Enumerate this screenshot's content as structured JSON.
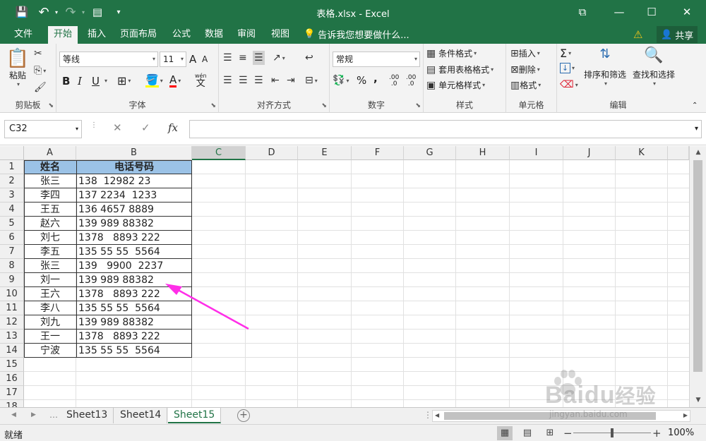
{
  "titlebar": {
    "title": "表格.xlsx - Excel",
    "save": "💾",
    "undo": "↶",
    "redo": "↷",
    "form": "▤",
    "customize": "▾",
    "ribbon_options": "⧉",
    "minimize": "—",
    "maximize": "☐",
    "close": "✕"
  },
  "tabs": [
    "文件",
    "开始",
    "插入",
    "页面布局",
    "公式",
    "数据",
    "审阅",
    "视图"
  ],
  "tell_me": "告诉我您想要做什么...",
  "share": "共享",
  "ribbon": {
    "clipboard": {
      "paste": "粘贴",
      "label": "剪贴板"
    },
    "font": {
      "name": "等线",
      "size": "11",
      "label": "字体",
      "bold": "B",
      "italic": "I",
      "underline": "U",
      "a_up": "A",
      "a_down": "A",
      "wen": "wén",
      "wen_char": "文"
    },
    "alignment": {
      "label": "对齐方式"
    },
    "number": {
      "format": "常规",
      "label": "数字",
      "percent": "%",
      "comma": ",",
      "dec_inc": ".00",
      "dec_dec": ".0"
    },
    "styles": {
      "conditional": "条件格式",
      "as_table": "套用表格格式",
      "cell_styles": "单元格样式",
      "label": "样式"
    },
    "cells": {
      "insert": "插入",
      "delete": "删除",
      "format": "格式",
      "label": "单元格"
    },
    "editing": {
      "sort_filter": "排序和筛选",
      "find_select": "查找和选择",
      "label": "编辑",
      "sigma": "Σ"
    }
  },
  "formula_bar": {
    "name_box": "C32",
    "fx": "fx",
    "cancel": "✕",
    "enter": "✓",
    "formula": ""
  },
  "columns": [
    "A",
    "B",
    "C",
    "D",
    "E",
    "F",
    "G",
    "H",
    "I",
    "J",
    "K"
  ],
  "selected_column": "C",
  "rows": [
    "1",
    "2",
    "3",
    "4",
    "5",
    "6",
    "7",
    "8",
    "9",
    "10",
    "11",
    "12",
    "13",
    "14",
    "15",
    "16",
    "17",
    "18"
  ],
  "table": {
    "header": [
      "姓名",
      "电话号码"
    ],
    "header_color": "#9bc2e6",
    "data": [
      [
        "张三",
        "138  12982 23"
      ],
      [
        "李四",
        "137 2234  1233"
      ],
      [
        "王五",
        "136 4657 8889"
      ],
      [
        "赵六",
        "139 989 88382"
      ],
      [
        "刘七",
        "1378   8893 222"
      ],
      [
        "李五",
        "135 55 55  5564"
      ],
      [
        "张三",
        "139   9900  2237"
      ],
      [
        "刘一",
        "139 989 88382"
      ],
      [
        "王六",
        "1378   8893 222"
      ],
      [
        "李八",
        "135 55 55  5564"
      ],
      [
        "刘九",
        "139 989 88382"
      ],
      [
        "王一",
        "1378   8893 222"
      ],
      [
        "宁波",
        "135 55 55  5564"
      ]
    ]
  },
  "annotation_arrow_color": "#ff2ee8",
  "sheets": [
    "Sheet13",
    "Sheet14",
    "Sheet15"
  ],
  "active_sheet": "Sheet15",
  "status": {
    "ready": "就绪",
    "zoom": "100%",
    "zoom_minus": "−",
    "zoom_plus": "+",
    "zoom_level": 0.5
  },
  "watermark": {
    "brand": "Bai",
    "brand2": "du",
    "suffix": "经验",
    "url": "jingyan.baidu.com"
  },
  "theme": {
    "excel_green": "#217346"
  }
}
